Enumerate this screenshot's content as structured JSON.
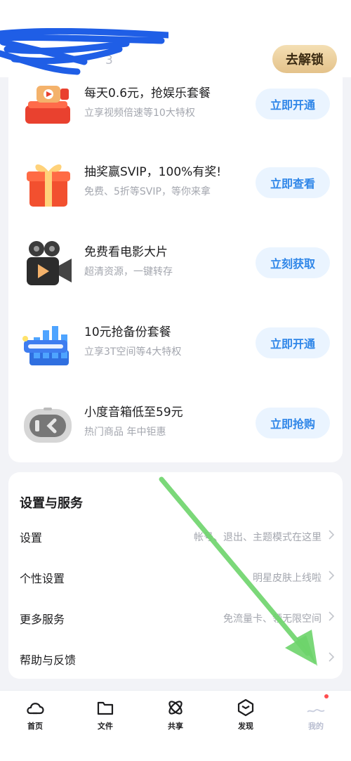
{
  "header": {
    "user_hint": "3",
    "unlock_label": "去解锁"
  },
  "promos": [
    {
      "title": "每天0.6元，抢娱乐套餐",
      "subtitle": "立享视频倍速等10大特权",
      "button": "立即开通",
      "icon": "video-camera-gift-icon"
    },
    {
      "title": "抽奖赢SVIP，100%有奖!",
      "subtitle": "免费、5折等SVIP，等你来拿",
      "button": "立即查看",
      "icon": "gift-box-icon"
    },
    {
      "title": "免费看电影大片",
      "subtitle": "超清资源，一键转存",
      "button": "立刻获取",
      "icon": "movie-camera-icon"
    },
    {
      "title": "10元抢备份套餐",
      "subtitle": "立享3T空间等4大特权",
      "button": "立即开通",
      "icon": "backup-package-icon"
    },
    {
      "title": "小度音箱低至59元",
      "subtitle": "热门商品 年中钜惠",
      "button": "立即抢购",
      "icon": "smart-speaker-icon"
    }
  ],
  "settings": {
    "title": "设置与服务",
    "rows": [
      {
        "label": "设置",
        "desc": "帐号、退出、主题模式在这里"
      },
      {
        "label": "个性设置",
        "desc": "明星皮肤上线啦"
      },
      {
        "label": "更多服务",
        "desc": "免流量卡、领无限空间"
      },
      {
        "label": "帮助与反馈",
        "desc": ""
      }
    ]
  },
  "tabs": [
    {
      "label": "首页",
      "icon": "cloud-home-icon"
    },
    {
      "label": "文件",
      "icon": "folder-icon"
    },
    {
      "label": "共享",
      "icon": "share-atom-icon"
    },
    {
      "label": "发现",
      "icon": "discover-cube-icon"
    },
    {
      "label": "我的",
      "icon": "profile-icon"
    }
  ],
  "colors": {
    "accent": "#2f86e8",
    "button_bg": "#eaf4ff",
    "unlock_gold": "#e4c28a",
    "annotation_arrow": "#6dd46a",
    "scribble": "#1f5ee6"
  }
}
